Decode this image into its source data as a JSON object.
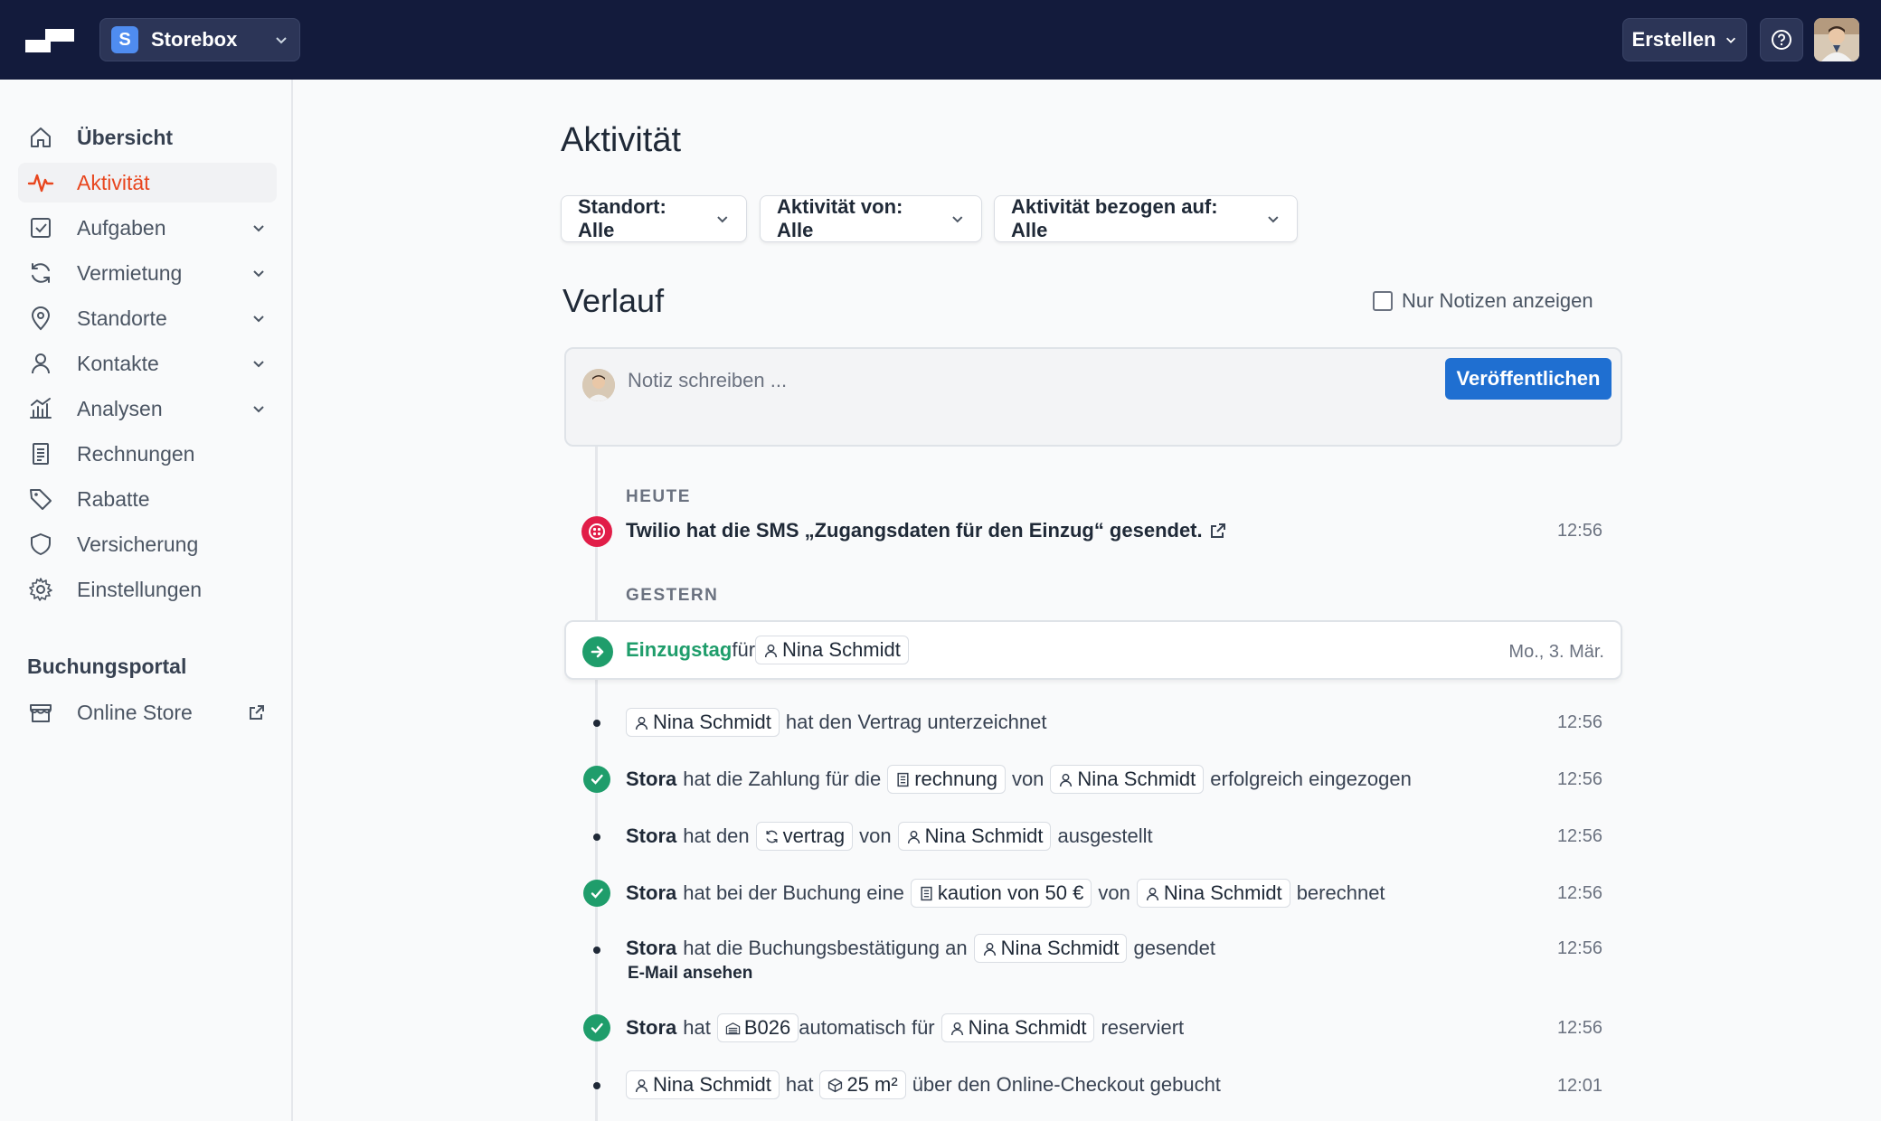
{
  "topbar": {
    "workspace_initial": "S",
    "workspace_name": "Storebox",
    "create_label": "Erstellen"
  },
  "sidebar": {
    "items": [
      {
        "label": "Übersicht"
      },
      {
        "label": "Aktivität"
      },
      {
        "label": "Aufgaben"
      },
      {
        "label": "Vermietung"
      },
      {
        "label": "Standorte"
      },
      {
        "label": "Kontakte"
      },
      {
        "label": "Analysen"
      },
      {
        "label": "Rechnungen"
      },
      {
        "label": "Rabatte"
      },
      {
        "label": "Versicherung"
      },
      {
        "label": "Einstellungen"
      }
    ],
    "section_title": "Buchungsportal",
    "online_store": "Online Store"
  },
  "main": {
    "title": "Aktivität",
    "filters": [
      "Standort: Alle",
      "Aktivität von: Alle",
      "Aktivität bezogen auf: Alle"
    ],
    "history_title": "Verlauf",
    "notes_only_label": "Nur Notizen anzeigen",
    "note_placeholder": "Notiz schreiben ...",
    "publish_label": "Veröffentlichen"
  },
  "timeline": {
    "today_label": "HEUTE",
    "yesterday_label": "GESTERN",
    "twilio": {
      "text": "Twilio hat die SMS „Zugangsdaten für den Einzug“ gesendet.",
      "time": "12:56"
    },
    "moveday": {
      "title": "Einzugstag",
      "for": "für",
      "contact": "Nina Schmidt",
      "date": "Mo., 3. Mär."
    },
    "e1": {
      "contact": "Nina Schmidt",
      "text": "hat den Vertrag unterzeichnet",
      "time": "12:56"
    },
    "e2": {
      "actor": "Stora",
      "t1": "hat die Zahlung für die",
      "chip1": "rechnung",
      "t2": "von",
      "contact": "Nina Schmidt",
      "t3": "erfolgreich eingezogen",
      "time": "12:56"
    },
    "e3": {
      "actor": "Stora",
      "t1": "hat den",
      "chip1": "vertrag",
      "t2": "von",
      "contact": "Nina Schmidt",
      "t3": "ausgestellt",
      "time": "12:56"
    },
    "e4": {
      "actor": "Stora",
      "t1": "hat bei der Buchung eine",
      "chip1": "kaution von 50 €",
      "t2": "von",
      "contact": "Nina Schmidt",
      "t3": "berechnet",
      "time": "12:56"
    },
    "e5": {
      "actor": "Stora",
      "t1": "hat die Buchungsbestätigung an",
      "contact": "Nina Schmidt",
      "t3": "gesendet",
      "link": "E-Mail ansehen",
      "time": "12:56"
    },
    "e6": {
      "actor": "Stora",
      "t1": "hat",
      "chip1": "B026",
      "t2": "automatisch für",
      "contact": "Nina Schmidt",
      "t3": "reserviert",
      "time": "12:56"
    },
    "e7": {
      "contact": "Nina Schmidt",
      "t1": "hat",
      "chip1": "25 m²",
      "t3": "über den Online-Checkout gebucht",
      "time": "12:01"
    }
  }
}
